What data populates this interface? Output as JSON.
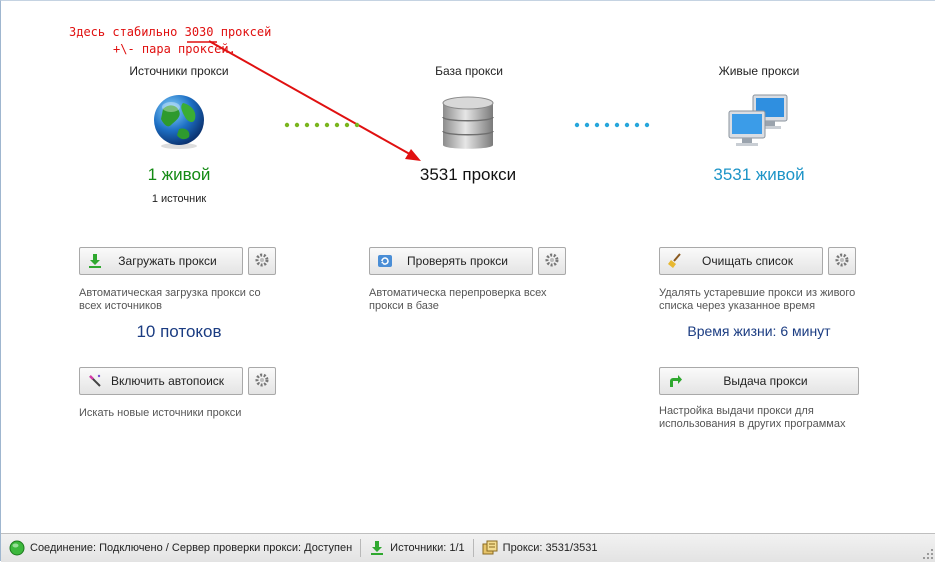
{
  "annotation": {
    "line1": "Здесь стабильно 3030 проксей",
    "line2": "+\\- пара проксей.",
    "color": "#e01010"
  },
  "columns": {
    "sources": {
      "title": "Источники прокси",
      "count": "1 живой",
      "sub": "1 источник",
      "count_color": "#138a13"
    },
    "base": {
      "title": "База прокси",
      "count": "3531 прокси"
    },
    "live": {
      "title": "Живые прокси",
      "count": "3531 живой",
      "count_color": "#1d94c7"
    }
  },
  "buttons": {
    "load": {
      "label": "Загружать прокси",
      "icon": "download-arrow-icon"
    },
    "check": {
      "label": "Проверять прокси",
      "icon": "refresh-icon"
    },
    "clean": {
      "label": "Очищать список",
      "icon": "broom-icon"
    },
    "autosearch": {
      "label": "Включить автопоиск",
      "icon": "wand-icon"
    },
    "deliver": {
      "label": "Выдача прокси",
      "icon": "green-arrow-icon"
    }
  },
  "descriptions": {
    "load": "Автоматическая загрузка прокси со всех источников",
    "check": "Автоматическа перепроверка всех прокси в базе",
    "clean": "Удалять устаревшие прокси из живого списка через указанное время",
    "autosearch": "Искать новые источники прокси",
    "deliver": "Настройка выдачи прокси для использования в других программах"
  },
  "stats": {
    "threads": "10 потоков",
    "lifetime": "Время жизни: 6 минут"
  },
  "statusbar": {
    "connection": "Соединение: Подключено / Сервер проверки прокси: Доступен",
    "sources": "Источники: 1/1",
    "proxies": "Прокси: 3531/3531"
  }
}
